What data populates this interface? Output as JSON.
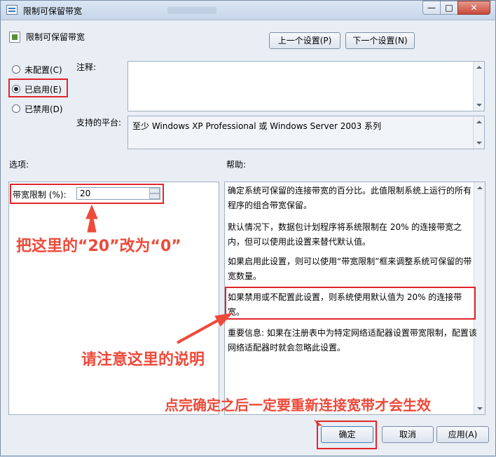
{
  "window": {
    "title": "限制可保留带宽",
    "controls": {
      "minimize": "—",
      "maximize": "□",
      "close": "✕"
    }
  },
  "setting_name": "限制可保留带宽",
  "nav": {
    "prev": "上一个设置(P)",
    "next": "下一个设置(N)"
  },
  "state": {
    "options": [
      {
        "label": "未配置(C)",
        "checked": false
      },
      {
        "label": "已启用(E)",
        "checked": true
      },
      {
        "label": "已禁用(D)",
        "checked": false
      }
    ]
  },
  "comment_label": "注释:",
  "platform_label": "支持的平台:",
  "platform_value": "至少 Windows XP Professional 或 Windows Server 2003 系列",
  "options_label": "选项:",
  "help_label": "帮助:",
  "bandwidth": {
    "label": "带宽限制 (%):",
    "value": "20"
  },
  "help_text": [
    "确定系统可保留的连接带宽的百分比。此值限制系统上运行的所有程序的组合带宽保留。",
    "默认情况下，数据包计划程序将系统限制在 20% 的连接带宽之内，但可以使用此设置来替代默认值。",
    "如果启用此设置，则可以使用“带宽限制”框来调整系统可保留的带宽数量。",
    "如果禁用或不配置此设置，则系统使用默认值为 20% 的连接带宽。",
    "重要信息: 如果在注册表中为特定网络适配器设置带宽限制，配置该网络适配器时就会忽略此设置。"
  ],
  "annotations": {
    "change_value": "把这里的“20”改为“0”",
    "note_description": "请注意这里的说明",
    "reconnect": "点完确定之后一定要重新连接宽带才会生效"
  },
  "buttons": {
    "ok": "确定",
    "cancel": "取消",
    "apply": "应用(A)"
  },
  "colors": {
    "annotation": "#ee4a3a",
    "highlight_box": "#e0262b"
  }
}
